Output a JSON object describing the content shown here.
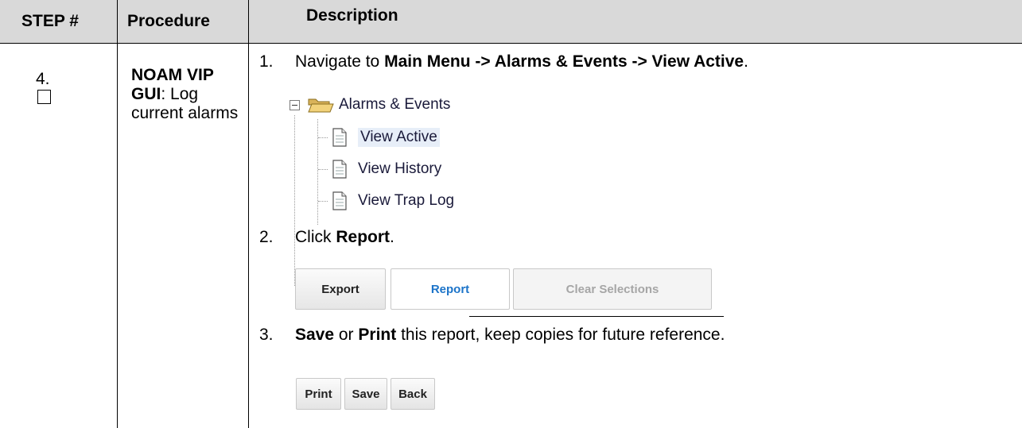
{
  "header": {
    "step": "STEP #",
    "procedure": "Procedure",
    "description": "Description"
  },
  "row": {
    "step_number": "4.",
    "procedure_bold": "NOAM VIP GUI",
    "procedure_rest": ": Log current alarms"
  },
  "steps": [
    {
      "num": "1.",
      "pre": "Navigate to ",
      "bold": "Main Menu -> Alarms & Events -> View Active",
      "post": "."
    },
    {
      "num": "2.",
      "pre": "Click ",
      "bold": "Report",
      "post": "."
    },
    {
      "num": "3.",
      "bold1": "Save",
      "mid": " or ",
      "bold2": "Print",
      "post": " this report, keep copies for future reference."
    }
  ],
  "tree": {
    "root": "Alarms & Events",
    "items": [
      "View Active",
      "View History",
      "View Trap Log"
    ],
    "root_icon": "folder-open-icon",
    "item_icon": "document-icon",
    "toggle_icon": "collapse-minus-icon"
  },
  "buttons_row1": [
    "Export",
    "Report",
    "Clear Selections"
  ],
  "buttons_row2": [
    "Print",
    "Save",
    "Back"
  ],
  "colors": {
    "header_bg": "#d9d9d9",
    "link_blue": "#1c74c9",
    "disabled_text": "#a6a6a6"
  }
}
